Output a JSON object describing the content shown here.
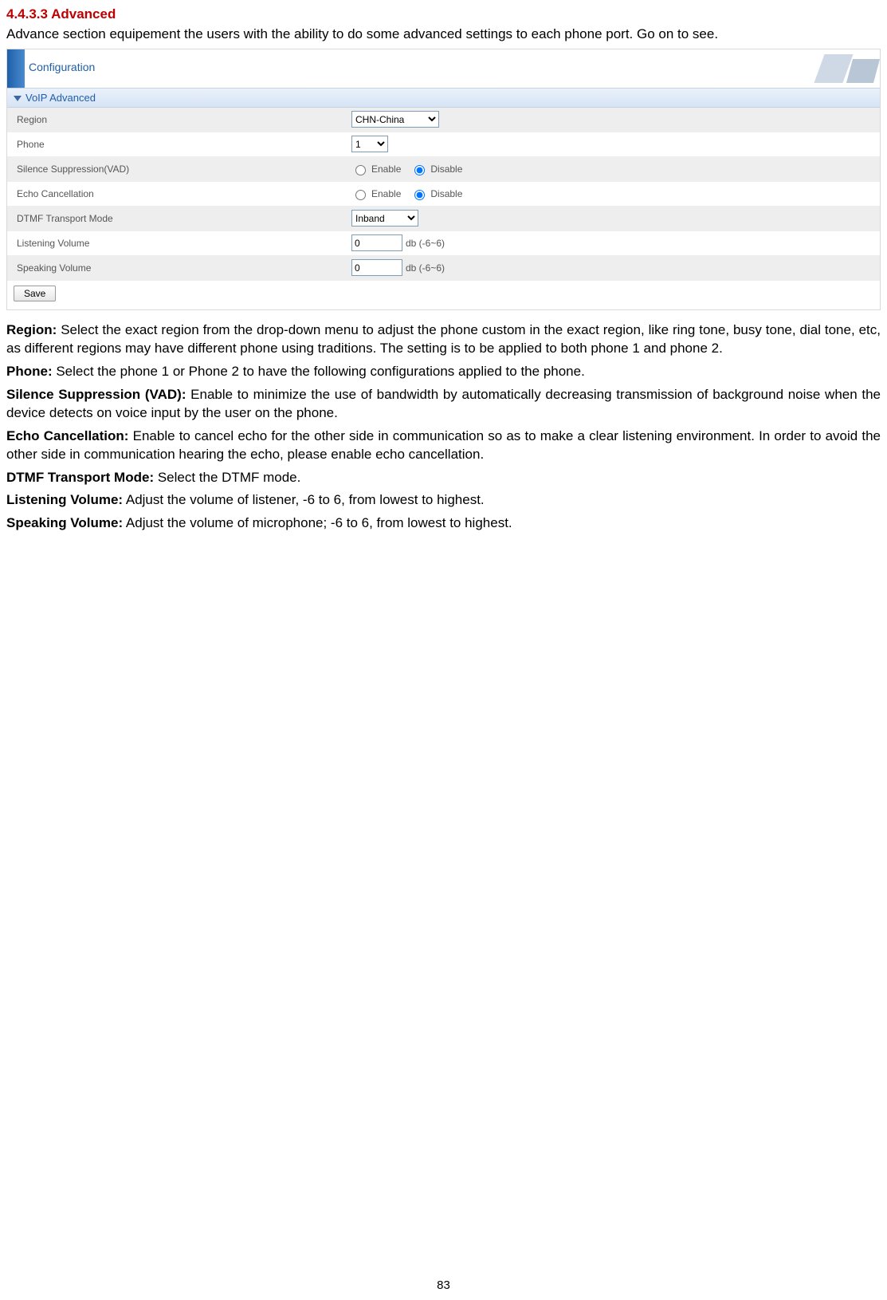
{
  "heading": "4.4.3.3 Advanced",
  "intro": "Advance section equipement the users with the ability to do some advanced settings to each phone port. Go on to see.",
  "panel": {
    "title": "Configuration",
    "section": "VoIP Advanced",
    "rows": {
      "region": {
        "label": "Region",
        "value": "CHN-China"
      },
      "phone": {
        "label": "Phone",
        "value": "1"
      },
      "vad": {
        "label": "Silence Suppression(VAD)",
        "enable": "Enable",
        "disable": "Disable",
        "selected": "disable"
      },
      "echo": {
        "label": "Echo Cancellation",
        "enable": "Enable",
        "disable": "Disable",
        "selected": "disable"
      },
      "dtmf": {
        "label": "DTMF Transport Mode",
        "value": "Inband"
      },
      "lvol": {
        "label": "Listening Volume",
        "value": "0",
        "suffix": "db (-6~6)"
      },
      "svol": {
        "label": "Speaking Volume",
        "value": "0",
        "suffix": "db (-6~6)"
      }
    },
    "save": "Save"
  },
  "descriptions": {
    "region_b": "Region:",
    "region_t": " Select the exact region from the drop-down menu to adjust the phone custom in the exact region, like ring tone, busy tone, dial tone, etc, as different regions may have different phone using traditions. The setting is to be applied to both phone 1 and phone 2.",
    "phone_b": "Phone:",
    "phone_t": " Select the phone 1 or Phone 2 to have the following configurations applied to the phone.",
    "vad_b": "Silence Suppression (VAD):",
    "vad_t": " Enable to minimize the use of bandwidth by automatically decreasing transmission of background noise when the device detects on voice input by the user on the phone.",
    "echo_b": "Echo Cancellation:",
    "echo_t": " Enable to cancel echo for the other side in communication so as to make a clear listening environment. In order to avoid the other side in communication hearing the echo, please enable echo cancellation.",
    "dtmf_b": "DTMF Transport Mode:",
    "dtmf_t": " Select the DTMF mode.",
    "lvol_b": "Listening Volume:",
    "lvol_t": " Adjust the volume of listener, -6 to 6, from lowest to highest.",
    "svol_b": "Speaking Volume:",
    "svol_t": "  Adjust the volume of microphone; -6 to 6, from lowest to highest."
  },
  "page_number": "83"
}
